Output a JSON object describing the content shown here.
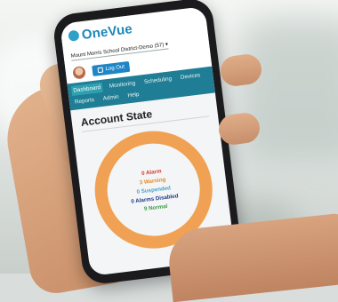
{
  "app": {
    "logo_text": "OneVue",
    "district": "Mount Morris School District-Demo (57)",
    "logout_label": "Log Out",
    "nav": [
      "Dashboard",
      "Monitoring",
      "Scheduling",
      "Devices",
      "Reports",
      "Admin",
      "Help"
    ],
    "active_nav": "Dashboard"
  },
  "dashboard": {
    "title": "Account State",
    "states": [
      {
        "label": "0 Alarm",
        "color": "#d93a2a"
      },
      {
        "label": "3 Warning",
        "color": "#e38b2b"
      },
      {
        "label": "0 Suspended",
        "color": "#4aa3c9"
      },
      {
        "label": "0 Alarms Disabled",
        "color": "#1f3b8a"
      },
      {
        "label": "9 Normal",
        "color": "#3f9a4a"
      }
    ],
    "ring_color": "#f0a153"
  }
}
